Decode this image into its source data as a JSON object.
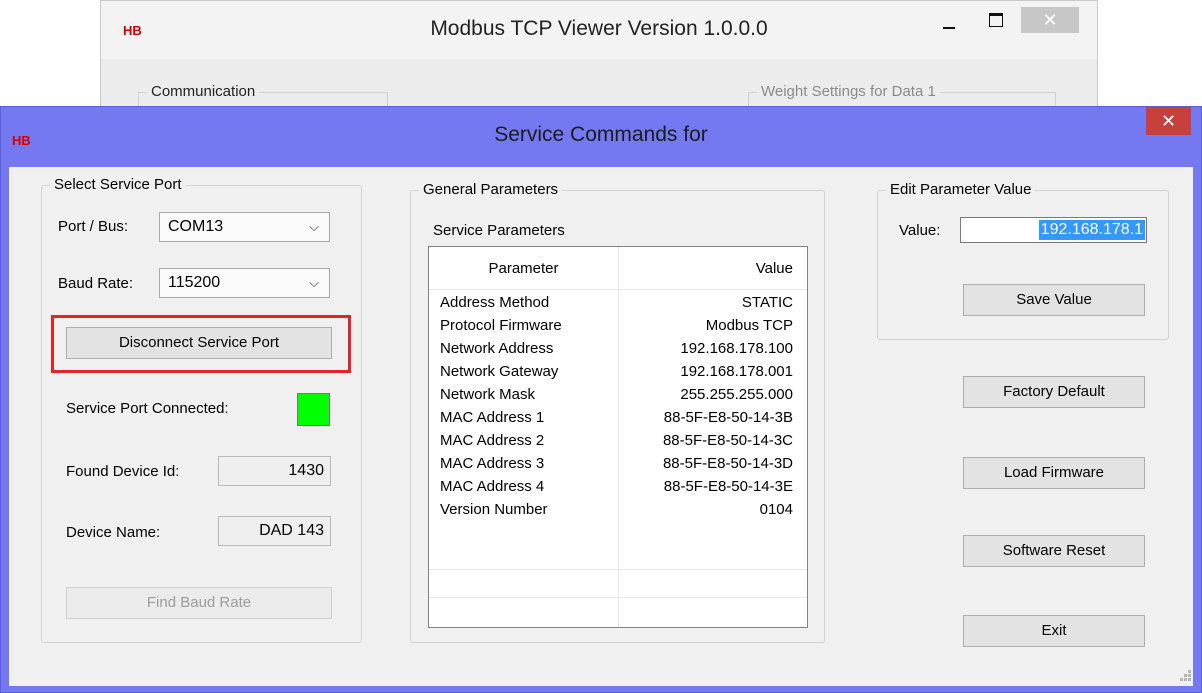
{
  "background_window": {
    "logo": "HB",
    "title": "Modbus TCP Viewer Version 1.0.0.0",
    "minimize_glyph": "–",
    "close_glyph": "✕",
    "communication_legend": "Communication",
    "weight_settings_legend": "Weight Settings for Data 1"
  },
  "dialog": {
    "logo": "HB",
    "title": "Service Commands for",
    "close_glyph": "✕",
    "active_title_color": "#7579f1"
  },
  "select_port": {
    "legend": "Select Service Port",
    "port_label": "Port / Bus:",
    "port_value": "COM13",
    "baud_label": "Baud Rate:",
    "baud_value": "115200",
    "disconnect_button": "Disconnect Service Port",
    "connected_label": "Service Port Connected:",
    "connected_status_color": "#00ff00",
    "device_id_label": "Found Device Id:",
    "device_id_value": "1430",
    "device_name_label": "Device Name:",
    "device_name_value": "DAD 143",
    "find_baud_button": "Find Baud Rate"
  },
  "general": {
    "legend": "General Parameters",
    "service_params_label": "Service Parameters",
    "table": {
      "headers": [
        "Parameter",
        "Value"
      ],
      "rows": [
        [
          "Address Method",
          "STATIC"
        ],
        [
          "Protocol Firmware",
          "Modbus TCP"
        ],
        [
          "Network Address",
          "192.168.178.100"
        ],
        [
          "Network Gateway",
          "192.168.178.001"
        ],
        [
          "Network Mask",
          "255.255.255.000"
        ],
        [
          "MAC Address 1",
          "88-5F-E8-50-14-3B"
        ],
        [
          "MAC Address 2",
          "88-5F-E8-50-14-3C"
        ],
        [
          "MAC Address 3",
          "88-5F-E8-50-14-3D"
        ],
        [
          "MAC Address 4",
          "88-5F-E8-50-14-3E"
        ],
        [
          "Version Number",
          "0104"
        ]
      ]
    }
  },
  "edit": {
    "legend": "Edit Parameter Value",
    "value_label": "Value:",
    "value": "192.168.178.1",
    "save_button": "Save Value"
  },
  "actions": {
    "factory_default": "Factory Default",
    "load_firmware": "Load Firmware",
    "software_reset": "Software Reset",
    "exit": "Exit"
  }
}
